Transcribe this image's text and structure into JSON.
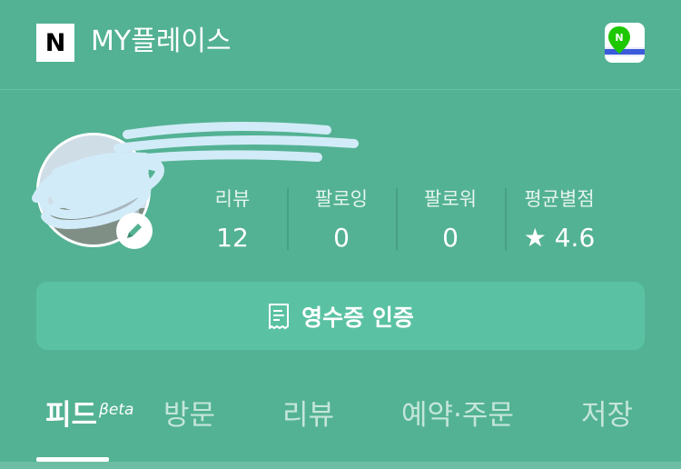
{
  "header": {
    "logo_letter": "N",
    "title": "MY플레이스",
    "map_icon": "map-pin-icon"
  },
  "profile": {
    "edit_icon": "pencil-icon"
  },
  "stats": [
    {
      "label": "리뷰",
      "value": "12"
    },
    {
      "label": "팔로잉",
      "value": "0"
    },
    {
      "label": "팔로워",
      "value": "0"
    },
    {
      "label": "평균별점",
      "value": "★ 4.6"
    }
  ],
  "receipt_button": {
    "label": "영수증 인증",
    "icon": "receipt-icon"
  },
  "tabs": [
    {
      "label": "피드",
      "badge": "βeta"
    },
    {
      "label": "방문"
    },
    {
      "label": "리뷰"
    },
    {
      "label": "예약·주문"
    },
    {
      "label": "저장"
    }
  ],
  "colors": {
    "background": "#53b293",
    "button": "#5ac2a3",
    "text": "#ffffff"
  }
}
